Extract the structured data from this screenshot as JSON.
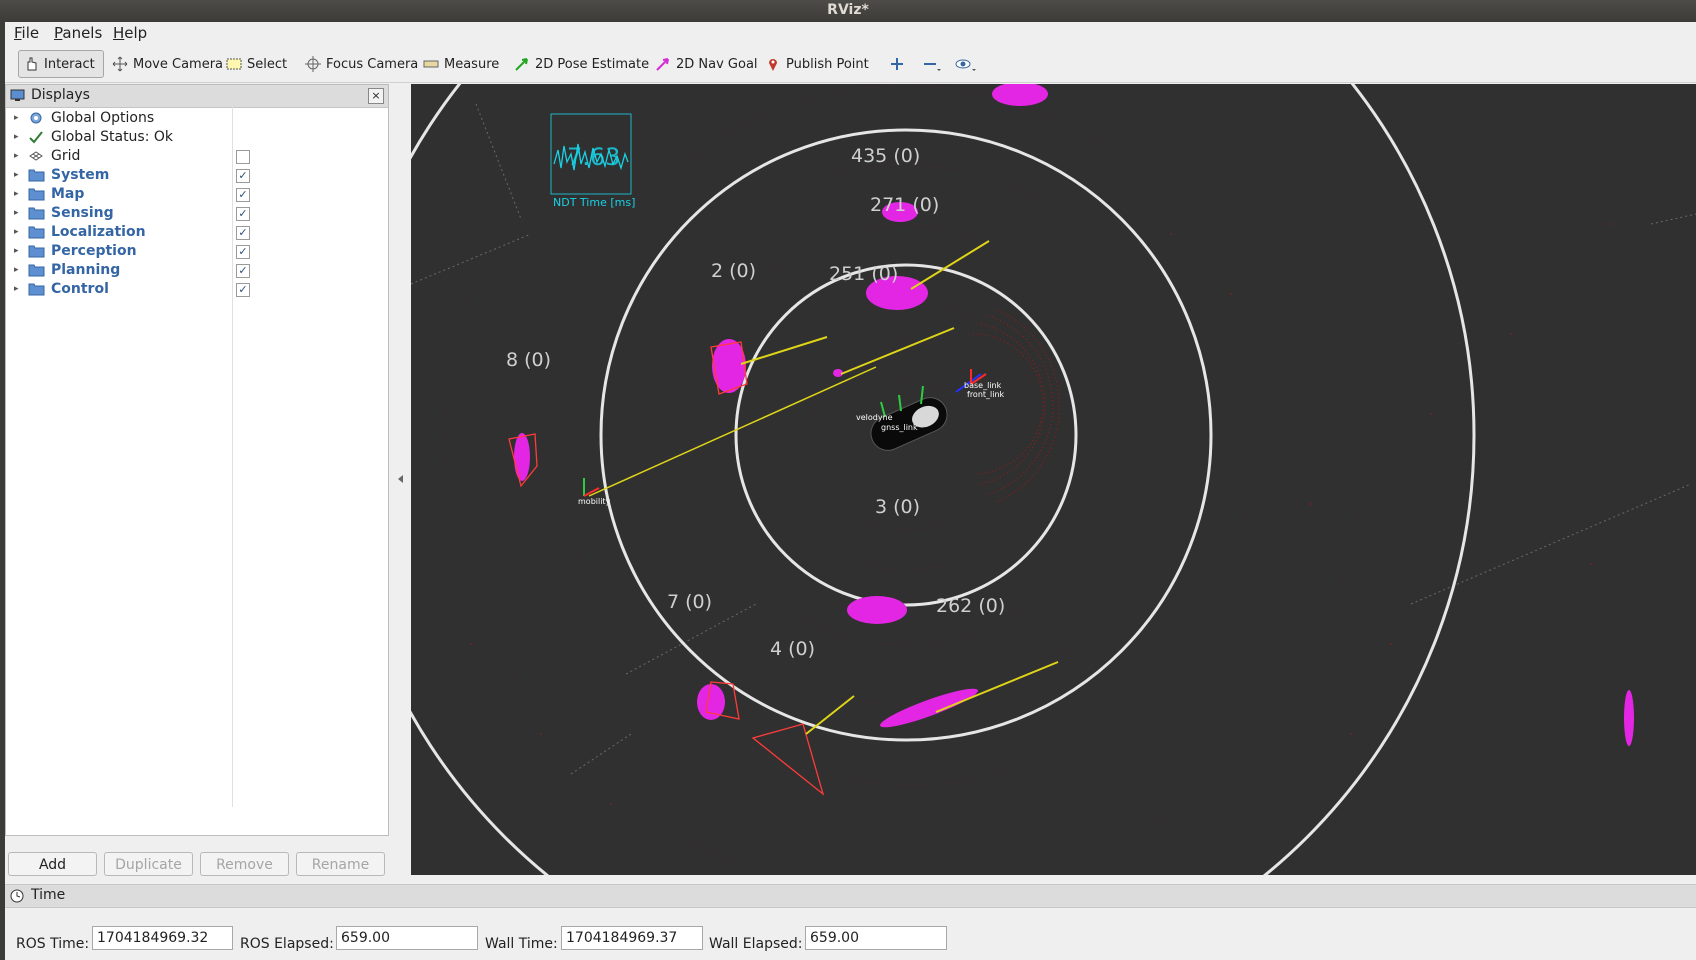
{
  "window": {
    "title": "RViz*"
  },
  "menu": [
    {
      "label": "File",
      "mnemonic": "F",
      "rest": "ile"
    },
    {
      "label": "Panels",
      "mnemonic": "P",
      "rest": "anels"
    },
    {
      "label": "Help",
      "mnemonic": "H",
      "rest": "elp"
    }
  ],
  "toolbar": {
    "interact": "Interact",
    "move_camera": "Move Camera",
    "select": "Select",
    "focus_camera": "Focus Camera",
    "measure": "Measure",
    "pose_estimate": "2D Pose Estimate",
    "nav_goal": "2D Nav Goal",
    "publish_point": "Publish Point"
  },
  "displays": {
    "title": "Displays",
    "close": "×",
    "items": [
      {
        "label": "Global Options",
        "icon": "gear-icon",
        "group": false,
        "checkbox": null
      },
      {
        "label": "Global Status: Ok",
        "icon": "checkmark-icon",
        "group": false,
        "checkbox": null
      },
      {
        "label": "Grid",
        "icon": "grid-icon",
        "group": false,
        "checkbox": false
      },
      {
        "label": "System",
        "icon": "folder-icon",
        "group": true,
        "checkbox": true
      },
      {
        "label": "Map",
        "icon": "folder-icon",
        "group": true,
        "checkbox": true
      },
      {
        "label": "Sensing",
        "icon": "folder-icon",
        "group": true,
        "checkbox": true
      },
      {
        "label": "Localization",
        "icon": "folder-icon",
        "group": true,
        "checkbox": true
      },
      {
        "label": "Perception",
        "icon": "folder-icon",
        "group": true,
        "checkbox": true
      },
      {
        "label": "Planning",
        "icon": "folder-icon",
        "group": true,
        "checkbox": true
      },
      {
        "label": "Control",
        "icon": "folder-icon",
        "group": true,
        "checkbox": true
      }
    ],
    "buttons": {
      "add": "Add",
      "duplicate": "Duplicate",
      "remove": "Remove",
      "rename": "Rename"
    }
  },
  "viewport": {
    "background": "#303030",
    "ndt_label": "NDT Time [ms]",
    "ndt_value": "7.63",
    "objects": [
      {
        "id": "435",
        "status": "(0)"
      },
      {
        "id": "271",
        "status": "(0)"
      },
      {
        "id": "2",
        "status": "(0)"
      },
      {
        "id": "251",
        "status": "(0)"
      },
      {
        "id": "8",
        "status": "(0)"
      },
      {
        "id": "3",
        "status": "(0)"
      },
      {
        "id": "7",
        "status": "(0)"
      },
      {
        "id": "262",
        "status": "(0)"
      },
      {
        "id": "4",
        "status": "(0)"
      }
    ],
    "frames": {
      "base": "base_link",
      "front": "front_link",
      "velodyne": "velodyne",
      "gnss": "gnss_link",
      "map": "mobility"
    }
  },
  "time": {
    "title": "Time",
    "ros_time_label": "ROS Time:",
    "ros_time": "1704184969.32",
    "ros_elapsed_label": "ROS Elapsed:",
    "ros_elapsed": "659.00",
    "wall_time_label": "Wall Time:",
    "wall_time": "1704184969.37",
    "wall_elapsed_label": "Wall Elapsed:",
    "wall_elapsed": "659.00"
  }
}
